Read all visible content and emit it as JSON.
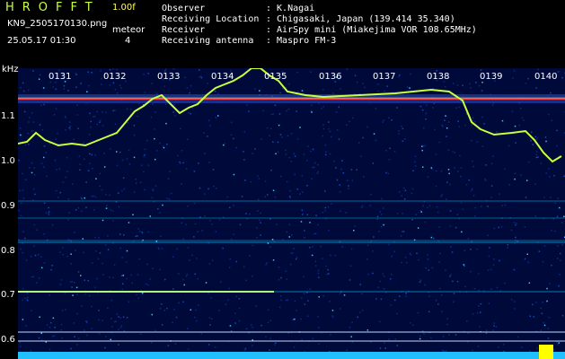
{
  "header": {
    "logo": "HROFFT",
    "version": "1.00f",
    "filename": "KN9_2505170130.png",
    "meteor_label": "meteor",
    "meteor_count": "4",
    "datetime": "25.05.17 01:30",
    "fields": [
      {
        "label": "Observer",
        "value": ": K.Nagai"
      },
      {
        "label": "Receiving Location",
        "value": ": Chigasaki, Japan (139.414 35.340)"
      },
      {
        "label": "Receiver",
        "value": ": AirSpy mini (Miakejima VOR 108.65MHz)"
      },
      {
        "label": "Receiving antenna",
        "value": ": Maspro FM-3"
      }
    ]
  },
  "spectrogram": {
    "y_unit": "kHz",
    "y_ticks": [
      "1.1",
      "1.0",
      "0.9",
      "0.8",
      "0.7",
      "0.6"
    ],
    "x_ticks": [
      "0131",
      "0132",
      "0133",
      "0134",
      "0135",
      "0136",
      "0137",
      "0138",
      "0139",
      "0140"
    ],
    "colors": {
      "background": "#000a3a",
      "signal": "#c8ff40",
      "carrier": "#ff4040",
      "noise": "#00c8ff"
    }
  }
}
